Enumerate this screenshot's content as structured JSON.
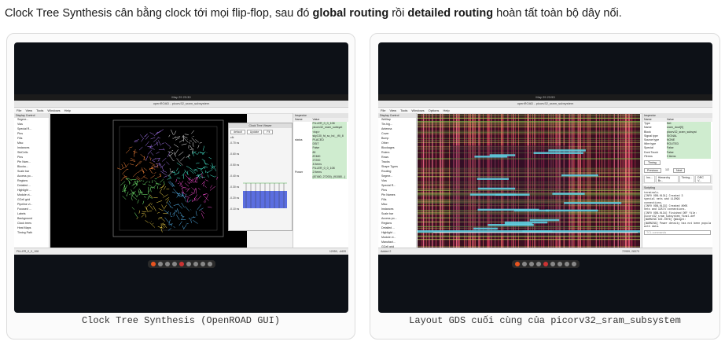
{
  "intro": {
    "part1": "Clock Tree Synthesis cân bằng clock tới mọi flip-flop, sau đó ",
    "bold1": "global routing",
    "part2": " rồi ",
    "bold2": "detailed routing",
    "part3": " hoàn tất toàn bộ dây nối."
  },
  "left_card": {
    "caption": "Clock Tree Synthesis (OpenROAD GUI)",
    "screen": {
      "clock": "May 29 23:30",
      "window_title": "openROAD - picorv32_sram_subsystem",
      "menu": [
        "File",
        "View",
        "Tools",
        "Windows",
        "Help"
      ],
      "display_control_title": "Display Control",
      "display_items": [
        "Segme...",
        "Vias",
        "Special R...",
        "Pins",
        "Fills",
        "Misc",
        "Instances",
        "StdCells",
        "Pins",
        "Pin Nam...",
        "Blocka...",
        "Scale bar",
        "Access po...",
        "Regions",
        "Detailed ...",
        "Highlight ...",
        "Module vi...",
        "GCell grid",
        "Pipeline vi...",
        "Focused ...",
        "Labels",
        "Background",
        "Clock trees",
        "Heat Maps",
        "Timing Path"
      ],
      "clock_tree_viewer": {
        "title": "Clock Tree Viewer",
        "preset": "default",
        "update": "Update",
        "fit": "Fit",
        "clk": "clk",
        "times": [
          "-0.70 ns",
          "-0.60 ns",
          "-0.50 ns",
          "-0.40 ns",
          "-0.30 ns",
          "-0.20 ns",
          "-0.10 ns"
        ]
      },
      "inspector_title": "Inspector",
      "inspector_rows": [
        [
          "Name",
          "Value"
        ],
        [
          "",
          "FILLER_0_0_108"
        ],
        [
          "",
          "picorv32_sram_subsyst"
        ],
        [
          "",
          "<top>"
        ],
        [
          "",
          "sky130_fd_sc_hd__fill_8"
        ],
        [
          "status",
          "PLACED"
        ],
        [
          "",
          "DSIT"
        ],
        [
          "",
          "False"
        ],
        [
          "",
          "80"
        ],
        [
          "",
          "87480"
        ],
        [
          "",
          "27200"
        ],
        [
          "",
          "4 items"
        ],
        [
          "",
          "FILLER_0_0_108"
        ],
        [
          "Power",
          "2 items"
        ],
        [
          "",
          "(87480, 27200), (91080...)"
        ]
      ],
      "status_left": "FILLER_0_0_108",
      "status_right": "12050, -4420"
    }
  },
  "right_card": {
    "caption": "Layout GDS cuối cùng của picorv32_sram_subsystem",
    "screen": {
      "clock": "May 29 23:53",
      "window_title": "openROAD - picorv32_sram_subsystem",
      "menu": [
        "File",
        "View",
        "Tools",
        "Windows",
        "Options",
        "Help"
      ],
      "display_control_title": "Display Control",
      "display_items": [
        "Welltap",
        "Tie-hig...",
        "Antenna",
        "Cover",
        "Bump",
        "Other",
        "Blockages",
        "Rulers",
        "Rows",
        "Tracks",
        "Shape Types",
        "Routing",
        "Segme...",
        "Vias",
        "Special R...",
        "Pins",
        "Pin Names",
        "Fills",
        "Misc",
        "Instances",
        "Scale bar",
        "Access po...",
        "Regions",
        "Detailed ...",
        "Highlight ...",
        "Module vi...",
        "Manufact...",
        "GCell grid"
      ],
      "inspector_title": "Inspector",
      "inspector_rows": [
        [
          "Name",
          "Value"
        ],
        [
          "Type",
          "Net"
        ],
        [
          "Name",
          "sram_dout[9]"
        ],
        [
          "Block",
          "picorv32_sram_subsyst"
        ],
        [
          "Signal type",
          "SIGNAL"
        ],
        [
          "Source type",
          "NONE"
        ],
        [
          "Wire type",
          "ROUTED"
        ],
        [
          "Special",
          "False"
        ],
        [
          "Dont Touch",
          "False"
        ],
        [
          "ITerms",
          "3 items"
        ]
      ],
      "buttons": [
        "Timing",
        "Previous",
        "1/2",
        "Next"
      ],
      "tabs": [
        "Ins...",
        "Hierarchy Br...",
        "Timing...",
        "DRC V..."
      ],
      "scripting_title": "Scripting",
      "log_lines": [
        "terminals.",
        "[INFO ODB-0131] Created 3",
        "special nets and 112099",
        "connections.",
        "[INFO ODB-0133] Created 8005",
        "nets and 32574 connections.",
        "[INFO ODB-0134] Finished DEF file:",
        "picorv32_sram_subsystem_final.def",
        "[WARNING GUI-0076] QWidget:",
        "[WARNING] Power density has not been populated",
        "with data."
      ],
      "prompt": "TCL commands",
      "status_left": "Added 2",
      "status_right": "72959, 28370"
    }
  }
}
